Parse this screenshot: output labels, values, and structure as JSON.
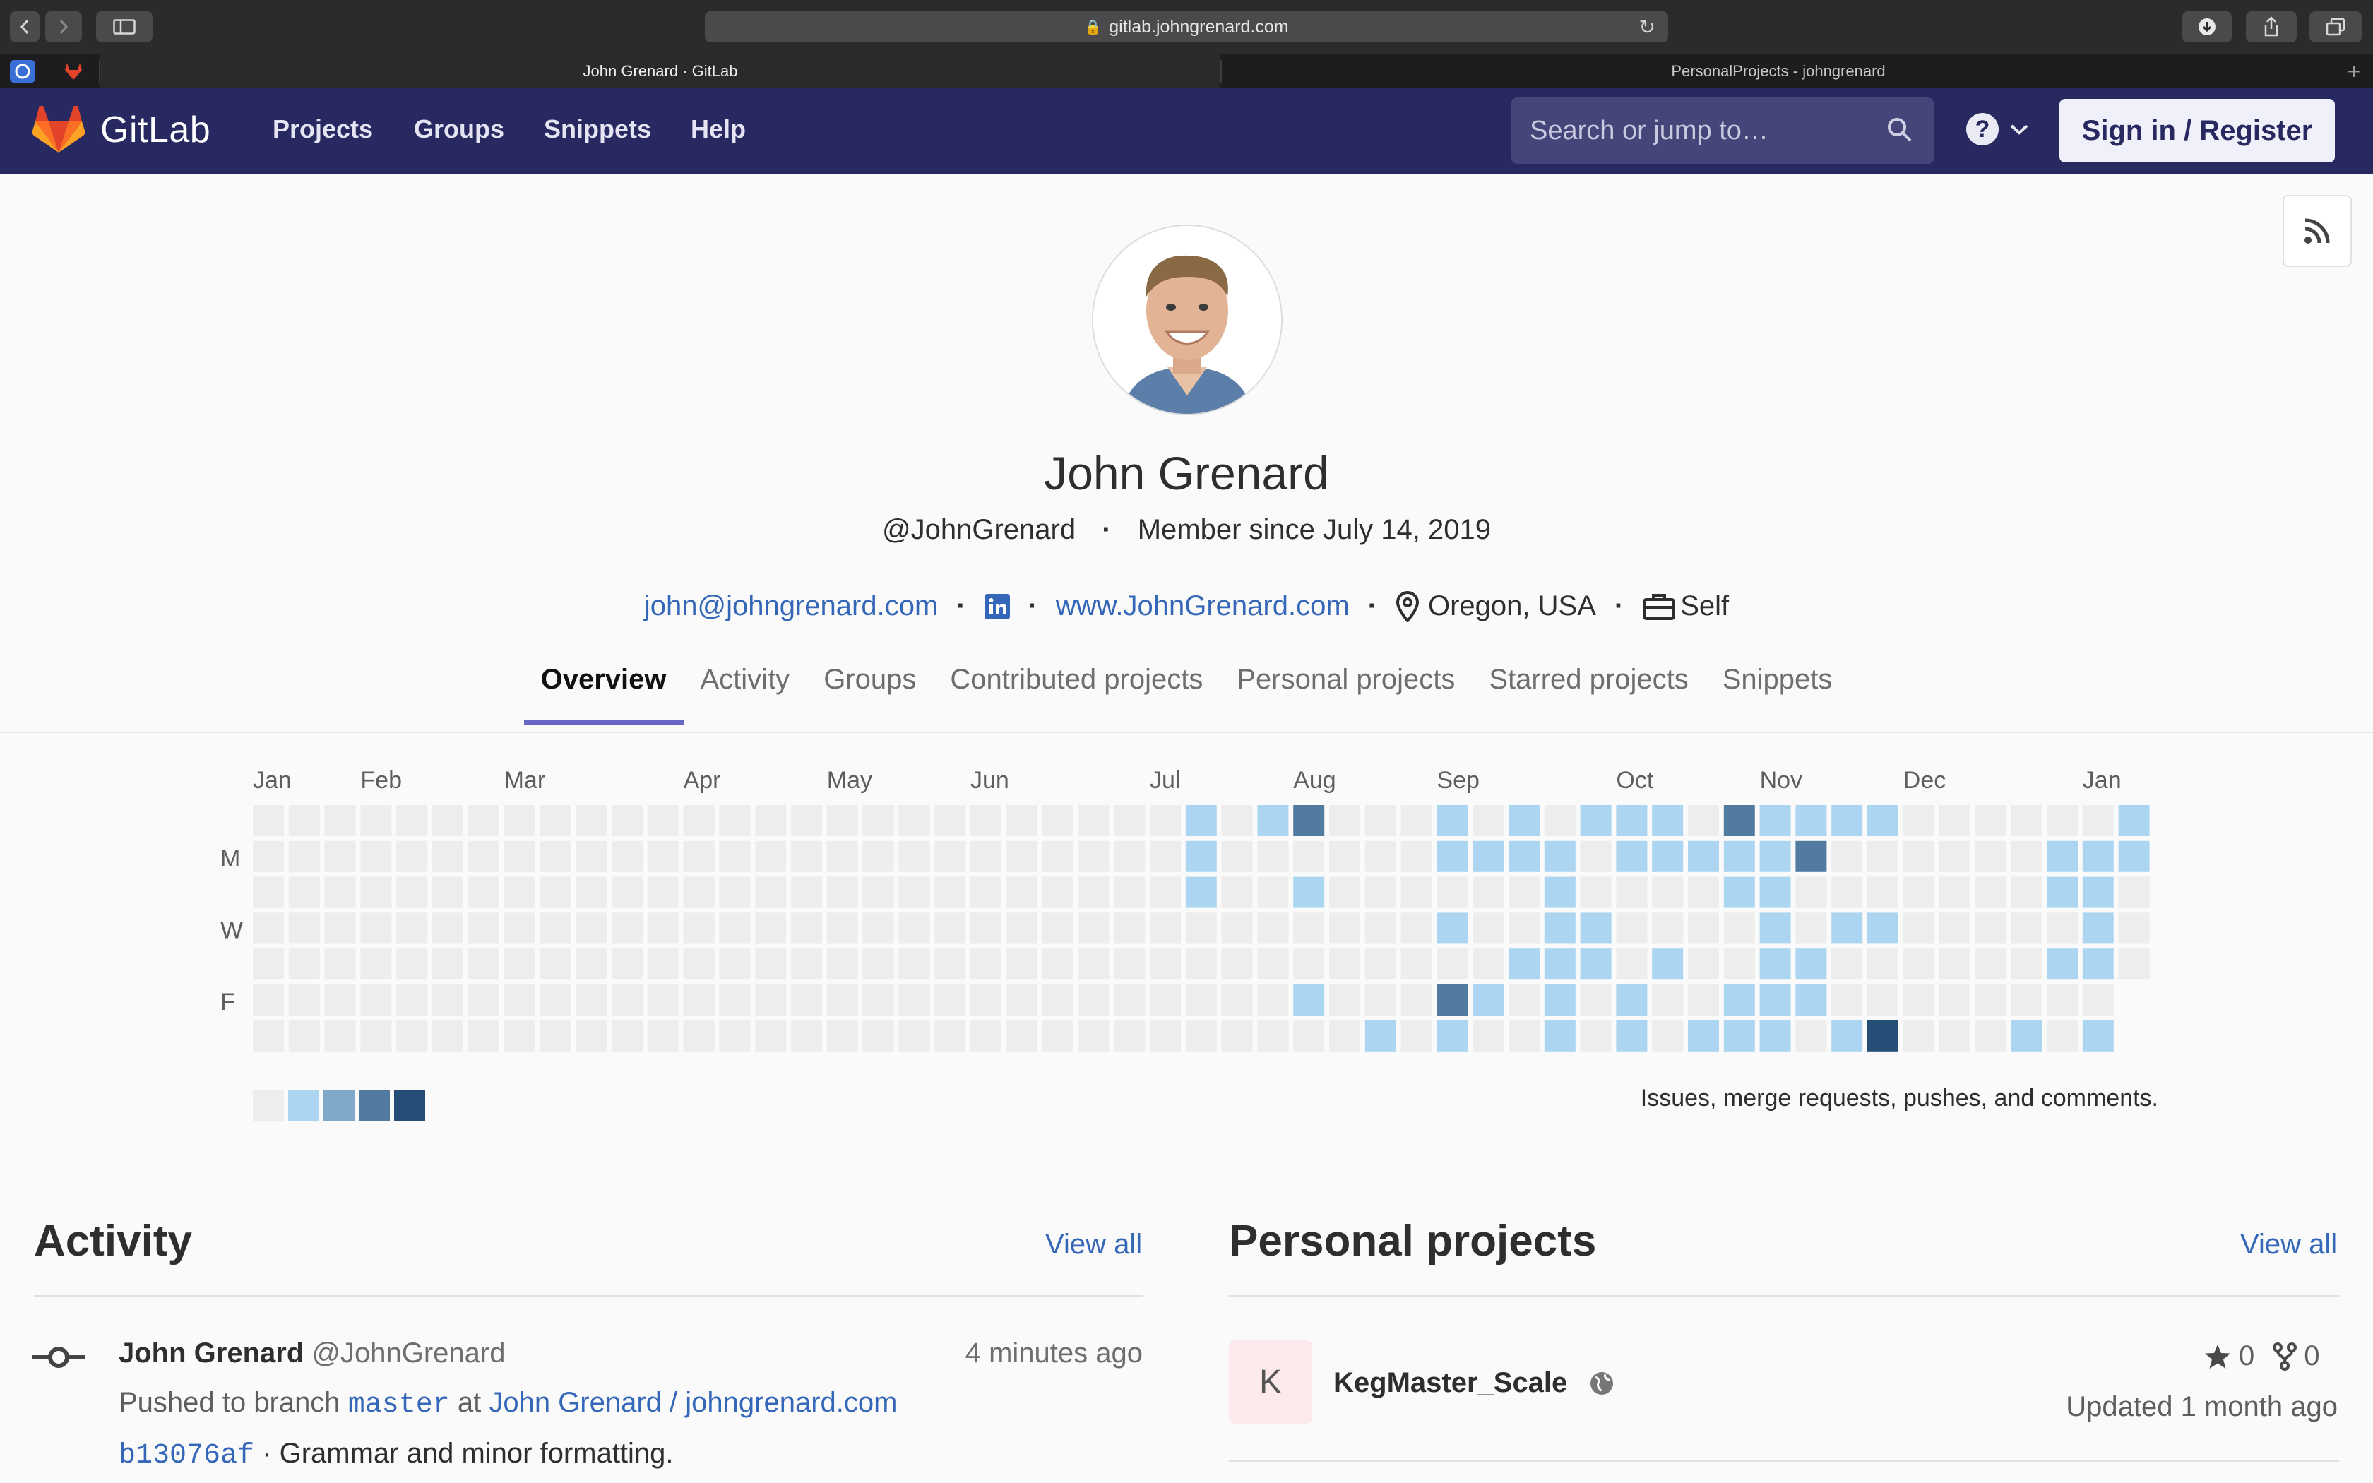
{
  "browser": {
    "url": "gitlab.johngrenard.com",
    "tabs": [
      {
        "title": "John Grenard · GitLab",
        "active": true
      },
      {
        "title": "PersonalProjects - johngrenard",
        "active": false
      }
    ],
    "new_tab": "+"
  },
  "header": {
    "brand": "GitLab",
    "nav": [
      "Projects",
      "Groups",
      "Snippets",
      "Help"
    ],
    "search_placeholder": "Search or jump to…",
    "help_label": "?",
    "signin_label": "Sign in / Register",
    "color": "#292961"
  },
  "profile": {
    "name": "John Grenard",
    "handle": "@JohnGrenard",
    "member_since": "Member since July 14, 2019",
    "email": "john@johngrenard.com",
    "website": "www.JohnGrenard.com",
    "location": "Oregon, USA",
    "work": "Self",
    "linkedin_icon": "linkedin-icon"
  },
  "tabs": [
    "Overview",
    "Activity",
    "Groups",
    "Contributed projects",
    "Personal projects",
    "Starred projects",
    "Snippets"
  ],
  "calendar": {
    "months": [
      "Jan",
      "Feb",
      "Mar",
      "Apr",
      "May",
      "Jun",
      "Jul",
      "Aug",
      "Sep",
      "Oct",
      "Nov",
      "Dec",
      "Jan"
    ],
    "month_week_index": [
      0,
      3,
      7,
      12,
      16,
      20,
      25,
      29,
      33,
      38,
      42,
      46,
      51
    ],
    "day_labels": [
      {
        "row": 1,
        "label": "M"
      },
      {
        "row": 3,
        "label": "W"
      },
      {
        "row": 5,
        "label": "F"
      }
    ],
    "weeks": 53,
    "levels_colors": [
      "#ededed",
      "#acd5f2",
      "#7fa8c9",
      "#527ba0",
      "#254e77"
    ],
    "last_week_rows": 5,
    "activity": [
      [
        26,
        0,
        1
      ],
      [
        26,
        1,
        1
      ],
      [
        26,
        2,
        1
      ],
      [
        28,
        0,
        1
      ],
      [
        29,
        0,
        3
      ],
      [
        29,
        2,
        1
      ],
      [
        29,
        5,
        1
      ],
      [
        31,
        6,
        1
      ],
      [
        33,
        0,
        1
      ],
      [
        33,
        1,
        1
      ],
      [
        33,
        3,
        1
      ],
      [
        33,
        5,
        3
      ],
      [
        33,
        6,
        1
      ],
      [
        34,
        1,
        1
      ],
      [
        34,
        5,
        1
      ],
      [
        35,
        0,
        1
      ],
      [
        35,
        1,
        1
      ],
      [
        35,
        4,
        1
      ],
      [
        36,
        1,
        1
      ],
      [
        36,
        2,
        1
      ],
      [
        36,
        3,
        1
      ],
      [
        36,
        4,
        1
      ],
      [
        36,
        5,
        1
      ],
      [
        36,
        6,
        1
      ],
      [
        37,
        0,
        1
      ],
      [
        37,
        3,
        1
      ],
      [
        37,
        4,
        1
      ],
      [
        38,
        0,
        1
      ],
      [
        38,
        1,
        1
      ],
      [
        38,
        5,
        1
      ],
      [
        38,
        6,
        1
      ],
      [
        39,
        0,
        1
      ],
      [
        39,
        1,
        1
      ],
      [
        39,
        4,
        1
      ],
      [
        40,
        1,
        1
      ],
      [
        40,
        6,
        1
      ],
      [
        41,
        0,
        3
      ],
      [
        41,
        1,
        1
      ],
      [
        41,
        2,
        1
      ],
      [
        41,
        5,
        1
      ],
      [
        41,
        6,
        1
      ],
      [
        42,
        0,
        1
      ],
      [
        42,
        1,
        1
      ],
      [
        42,
        2,
        1
      ],
      [
        42,
        3,
        1
      ],
      [
        42,
        4,
        1
      ],
      [
        42,
        5,
        1
      ],
      [
        42,
        6,
        1
      ],
      [
        43,
        0,
        1
      ],
      [
        43,
        1,
        3
      ],
      [
        43,
        4,
        1
      ],
      [
        43,
        5,
        1
      ],
      [
        44,
        0,
        1
      ],
      [
        44,
        3,
        1
      ],
      [
        44,
        6,
        1
      ],
      [
        45,
        0,
        1
      ],
      [
        45,
        3,
        1
      ],
      [
        45,
        6,
        4
      ],
      [
        49,
        6,
        1
      ],
      [
        50,
        1,
        1
      ],
      [
        50,
        2,
        1
      ],
      [
        50,
        4,
        1
      ],
      [
        51,
        1,
        1
      ],
      [
        51,
        2,
        1
      ],
      [
        51,
        3,
        1
      ],
      [
        51,
        4,
        1
      ],
      [
        51,
        6,
        1
      ],
      [
        52,
        0,
        1
      ],
      [
        52,
        1,
        1
      ]
    ],
    "legend_text": "Issues, merge requests, pushes, and comments."
  },
  "activity_section": {
    "title": "Activity",
    "view_all": "View all",
    "event": {
      "author": "John Grenard",
      "handle": "@JohnGrenard",
      "time": "4 minutes ago",
      "action": "Pushed to branch",
      "branch": "master",
      "at": "at",
      "project": "John Grenard / johngrenard.com",
      "commit": "b13076af",
      "message": "· Grammar and minor formatting."
    }
  },
  "projects_section": {
    "title": "Personal projects",
    "view_all": "View all",
    "project": {
      "initial": "K",
      "name": "KegMaster_Scale",
      "stars": "0",
      "forks": "0",
      "updated": "Updated 1 month ago"
    }
  }
}
